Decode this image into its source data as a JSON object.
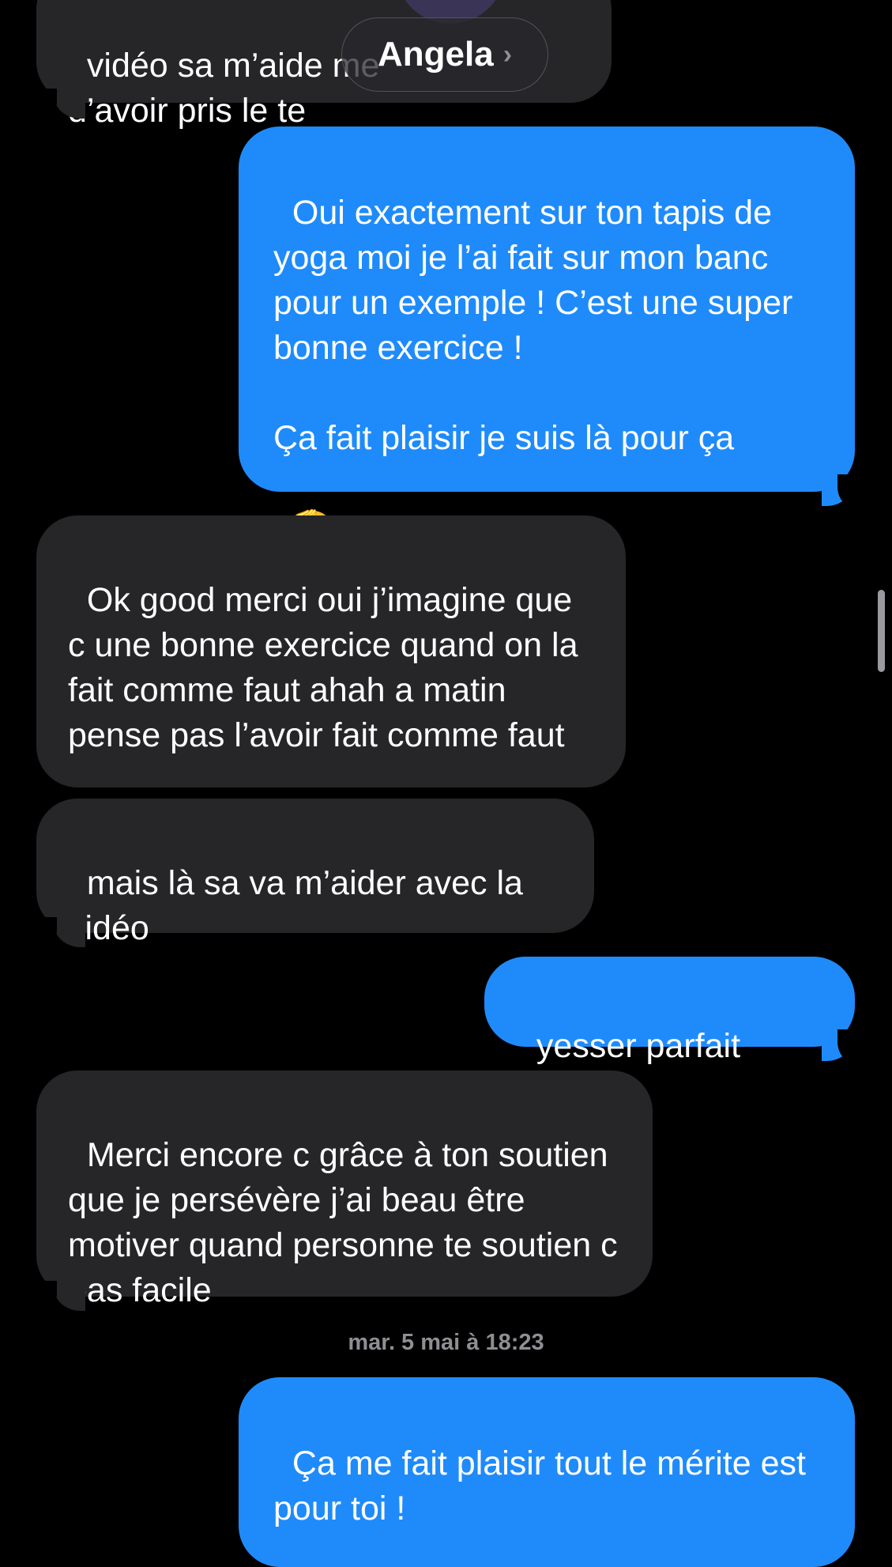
{
  "header": {
    "contact_name": "Angela",
    "chevron": "›"
  },
  "messages": [
    {
      "from": "them",
      "text": "vidéo sa m’aide me\nd’avoir pris le te"
    },
    {
      "from": "me",
      "text": "Oui exactement sur ton tapis de yoga moi je l’ai fait sur mon banc pour un exemple ! C’est une super bonne exercice !\n\nÇa fait plaisir je suis là pour ça",
      "emoji": "🫡"
    },
    {
      "from": "them",
      "text": "Ok good merci oui j’imagine que c une bonne exercice quand on la fait comme faut ahah a matin pense pas l’avoir fait comme faut"
    },
    {
      "from": "them",
      "text": "mais là sa va m’aider avec la vidéo"
    },
    {
      "from": "me",
      "text": "yesser parfait",
      "emoji": "👌"
    },
    {
      "from": "them",
      "text": "Merci encore c grâce à ton soutien que je persévère j’ai beau être motiver quand personne te soutien c pas facile"
    },
    {
      "from": "me",
      "text": "Ça me fait plaisir tout le mérite est pour toi !"
    }
  ],
  "timestamp": "mar. 5 mai à 18:23",
  "icons": {
    "salute": "saluting-face-icon",
    "ok": "ok-hand-icon",
    "chevron": "chevron-right-icon"
  },
  "colors": {
    "background": "#000000",
    "received_bubble": "#262628",
    "sent_bubble": "#1f8bfa",
    "timestamp_text": "#8e8e93"
  }
}
